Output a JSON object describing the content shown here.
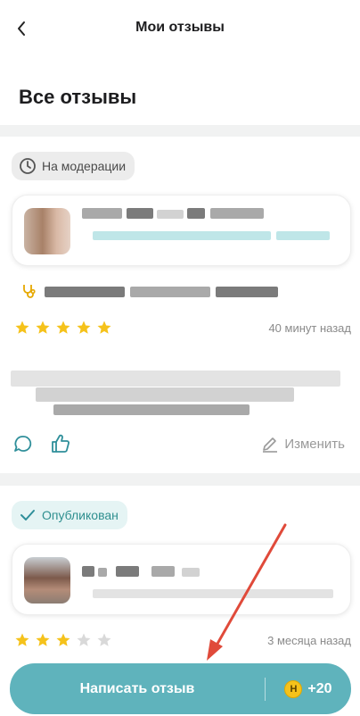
{
  "header": {
    "title": "Мои отзывы",
    "back_icon": "chevron-left-icon"
  },
  "page_title": "Все отзывы",
  "reviews": [
    {
      "status": "На модерации",
      "status_icon": "clock-icon",
      "rating": 5,
      "date": "40 минут назад",
      "actions": {
        "comment_icon": "comment-icon",
        "like_icon": "thumbs-up-icon",
        "edit_label": "Изменить",
        "edit_icon": "pencil-icon"
      }
    },
    {
      "status": "Опубликован",
      "status_icon": "check-icon",
      "rating": 3,
      "date": "3 месяца назад"
    }
  ],
  "cta": {
    "label": "Написать отзыв",
    "bonus": "+20",
    "coin_symbol": "Н"
  },
  "colors": {
    "accent": "#5fb3bc",
    "star_active": "#f5c21b",
    "star_inactive": "#d9d9d9",
    "arrow": "#e04a3a"
  }
}
